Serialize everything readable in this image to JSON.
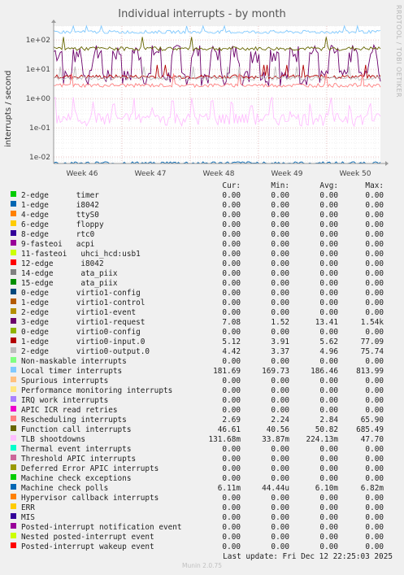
{
  "chart_data": {
    "type": "line",
    "title": "Individual interrupts - by month",
    "ylabel": "interrupts / second",
    "yscale": "log",
    "ylim": [
      0.006,
      300
    ],
    "yticks": [
      "1e+02",
      "1e+01",
      "1e+00",
      "1e-01",
      "1e-02"
    ],
    "xticks": [
      "Week 46",
      "Week 47",
      "Week 48",
      "Week 49",
      "Week 50"
    ],
    "columns": [
      "Cur:",
      "Min:",
      "Avg:",
      "Max:"
    ],
    "series": [
      {
        "name": "2-edge      timer",
        "color": "#00cc00",
        "cur": "0.00",
        "min": "0.00",
        "avg": "0.00",
        "max": "0.00"
      },
      {
        "name": "1-edge      i8042",
        "color": "#0066b3",
        "cur": "0.00",
        "min": "0.00",
        "avg": "0.00",
        "max": "0.00"
      },
      {
        "name": "4-edge      ttyS0",
        "color": "#ff8000",
        "cur": "0.00",
        "min": "0.00",
        "avg": "0.00",
        "max": "0.00"
      },
      {
        "name": "6-edge      floppy",
        "color": "#ffcc00",
        "cur": "0.00",
        "min": "0.00",
        "avg": "0.00",
        "max": "0.00"
      },
      {
        "name": "8-edge      rtc0",
        "color": "#330099",
        "cur": "0.00",
        "min": "0.00",
        "avg": "0.00",
        "max": "0.00"
      },
      {
        "name": "9-fasteoi   acpi",
        "color": "#990099",
        "cur": "0.00",
        "min": "0.00",
        "avg": "0.00",
        "max": "0.00"
      },
      {
        "name": "11-fasteoi   uhci_hcd:usb1",
        "color": "#ccff00",
        "cur": "0.00",
        "min": "0.00",
        "avg": "0.00",
        "max": "0.00"
      },
      {
        "name": "12-edge      i8042",
        "color": "#ff0000",
        "cur": "0.00",
        "min": "0.00",
        "avg": "0.00",
        "max": "0.00"
      },
      {
        "name": "14-edge      ata_piix",
        "color": "#808080",
        "cur": "0.00",
        "min": "0.00",
        "avg": "0.00",
        "max": "0.00"
      },
      {
        "name": "15-edge      ata_piix",
        "color": "#008f00",
        "cur": "0.00",
        "min": "0.00",
        "avg": "0.00",
        "max": "0.00"
      },
      {
        "name": "0-edge      virtio1-config",
        "color": "#00487d",
        "cur": "0.00",
        "min": "0.00",
        "avg": "0.00",
        "max": "0.00"
      },
      {
        "name": "1-edge      virtio1-control",
        "color": "#b35a00",
        "cur": "0.00",
        "min": "0.00",
        "avg": "0.00",
        "max": "0.00"
      },
      {
        "name": "2-edge      virtio1-event",
        "color": "#b38f00",
        "cur": "0.00",
        "min": "0.00",
        "avg": "0.00",
        "max": "0.00"
      },
      {
        "name": "3-edge      virtio1-request",
        "color": "#6b006b",
        "cur": "7.08",
        "min": "1.52",
        "avg": "13.41",
        "max": "1.54k"
      },
      {
        "name": "0-edge      virtio0-config",
        "color": "#8fb300",
        "cur": "0.00",
        "min": "0.00",
        "avg": "0.00",
        "max": "0.00"
      },
      {
        "name": "1-edge      virtio0-input.0",
        "color": "#b30000",
        "cur": "5.12",
        "min": "3.91",
        "avg": "5.62",
        "max": "77.09"
      },
      {
        "name": "2-edge      virtio0-output.0",
        "color": "#bebebe",
        "cur": "4.42",
        "min": "3.37",
        "avg": "4.96",
        "max": "75.74"
      },
      {
        "name": "Non-maskable interrupts",
        "color": "#80ff80",
        "cur": "0.00",
        "min": "0.00",
        "avg": "0.00",
        "max": "0.00"
      },
      {
        "name": "Local timer interrupts",
        "color": "#80c9ff",
        "cur": "181.69",
        "min": "169.73",
        "avg": "186.46",
        "max": "813.99"
      },
      {
        "name": "Spurious interrupts",
        "color": "#ffc080",
        "cur": "0.00",
        "min": "0.00",
        "avg": "0.00",
        "max": "0.00"
      },
      {
        "name": "Performance monitoring interrupts",
        "color": "#ffe680",
        "cur": "0.00",
        "min": "0.00",
        "avg": "0.00",
        "max": "0.00"
      },
      {
        "name": "IRQ work interrupts",
        "color": "#aa80ff",
        "cur": "0.00",
        "min": "0.00",
        "avg": "0.00",
        "max": "0.00"
      },
      {
        "name": "APIC ICR read retries",
        "color": "#ee00cc",
        "cur": "0.00",
        "min": "0.00",
        "avg": "0.00",
        "max": "0.00"
      },
      {
        "name": "Rescheduling interrupts",
        "color": "#ff8080",
        "cur": "2.69",
        "min": "2.24",
        "avg": "2.84",
        "max": "65.90"
      },
      {
        "name": "Function call interrupts",
        "color": "#666600",
        "cur": "46.61",
        "min": "40.56",
        "avg": "50.82",
        "max": "685.49"
      },
      {
        "name": "TLB shootdowns",
        "color": "#ffbfff",
        "cur": "131.68m",
        "min": "33.87m",
        "avg": "224.13m",
        "max": "47.70"
      },
      {
        "name": "Thermal event interrupts",
        "color": "#00ffcc",
        "cur": "0.00",
        "min": "0.00",
        "avg": "0.00",
        "max": "0.00"
      },
      {
        "name": "Threshold APIC interrupts",
        "color": "#cc6699",
        "cur": "0.00",
        "min": "0.00",
        "avg": "0.00",
        "max": "0.00"
      },
      {
        "name": "Deferred Error APIC interrupts",
        "color": "#999900",
        "cur": "0.00",
        "min": "0.00",
        "avg": "0.00",
        "max": "0.00"
      },
      {
        "name": "Machine check exceptions",
        "color": "#00cc00",
        "cur": "0.00",
        "min": "0.00",
        "avg": "0.00",
        "max": "0.00"
      },
      {
        "name": "Machine check polls",
        "color": "#0066b3",
        "cur": "6.11m",
        "min": "44.44u",
        "avg": "6.10m",
        "max": "6.82m"
      },
      {
        "name": "Hypervisor callback interrupts",
        "color": "#ff8000",
        "cur": "0.00",
        "min": "0.00",
        "avg": "0.00",
        "max": "0.00"
      },
      {
        "name": "ERR",
        "color": "#ffcc00",
        "cur": "0.00",
        "min": "0.00",
        "avg": "0.00",
        "max": "0.00"
      },
      {
        "name": "MIS",
        "color": "#330099",
        "cur": "0.00",
        "min": "0.00",
        "avg": "0.00",
        "max": "0.00"
      },
      {
        "name": "Posted-interrupt notification event",
        "color": "#990099",
        "cur": "0.00",
        "min": "0.00",
        "avg": "0.00",
        "max": "0.00"
      },
      {
        "name": "Nested posted-interrupt event",
        "color": "#ccff00",
        "cur": "0.00",
        "min": "0.00",
        "avg": "0.00",
        "max": "0.00"
      },
      {
        "name": "Posted-interrupt wakeup event",
        "color": "#ff0000",
        "cur": "0.00",
        "min": "0.00",
        "avg": "0.00",
        "max": "0.00"
      }
    ]
  },
  "side_text": "RRDTOOL / TOBI OETIKER",
  "last_update": "Last update: Fri Dec 12 22:25:03 2025",
  "footer": "Munin 2.0.75"
}
